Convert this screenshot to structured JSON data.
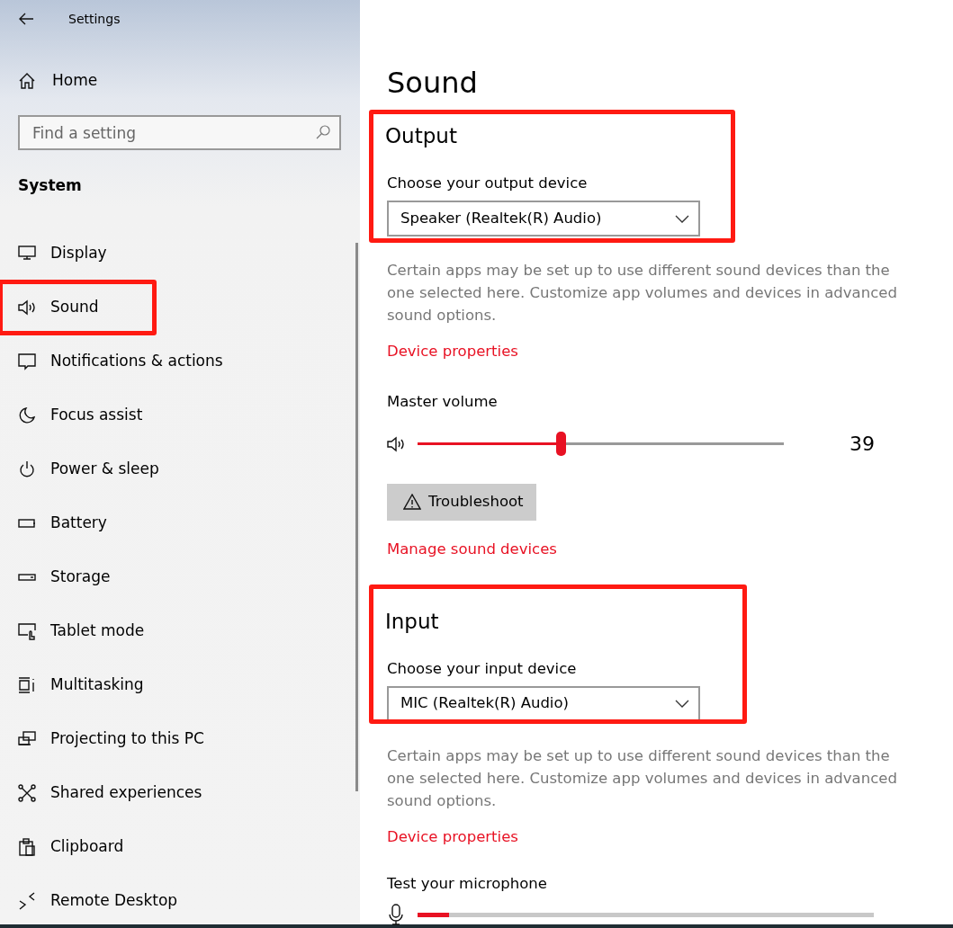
{
  "window": {
    "title": "Settings"
  },
  "sidebar": {
    "home": "Home",
    "search": {
      "placeholder": "Find a setting"
    },
    "section": "System",
    "items": [
      {
        "label": "Display",
        "highlighted": false
      },
      {
        "label": "Sound",
        "highlighted": true
      },
      {
        "label": "Notifications & actions",
        "highlighted": false
      },
      {
        "label": "Focus assist",
        "highlighted": false
      },
      {
        "label": "Power & sleep",
        "highlighted": false
      },
      {
        "label": "Battery",
        "highlighted": false
      },
      {
        "label": "Storage",
        "highlighted": false
      },
      {
        "label": "Tablet mode",
        "highlighted": false
      },
      {
        "label": "Multitasking",
        "highlighted": false
      },
      {
        "label": "Projecting to this PC",
        "highlighted": false
      },
      {
        "label": "Shared experiences",
        "highlighted": false
      },
      {
        "label": "Clipboard",
        "highlighted": false
      },
      {
        "label": "Remote Desktop",
        "highlighted": false
      }
    ]
  },
  "page_title": "Sound",
  "sections": [
    {
      "kind": "output",
      "heading": "Output",
      "highlighted": true,
      "device_label": "Choose your output device",
      "device": "Speaker (Realtek(R) Audio)",
      "note": "Certain apps may be set up to use different sound devices than the one selected here. Customize app volumes and devices in advanced sound options.",
      "properties_link": "Device properties",
      "volume_label": "Master volume",
      "volume": {
        "level": 0.39,
        "reading": "39"
      },
      "troubleshoot": "Troubleshoot",
      "manage_link": "Manage sound devices"
    },
    {
      "kind": "input",
      "heading": "Input",
      "highlighted": true,
      "device_label": "Choose your input device",
      "device": "MIC (Realtek(R) Audio)",
      "note": "Certain apps may be set up to use different sound devices than the one selected here. Customize app volumes and devices in advanced sound options.",
      "properties_link": "Device properties",
      "test_label": "Test your microphone",
      "meter": {
        "level": 0.07
      }
    }
  ]
}
